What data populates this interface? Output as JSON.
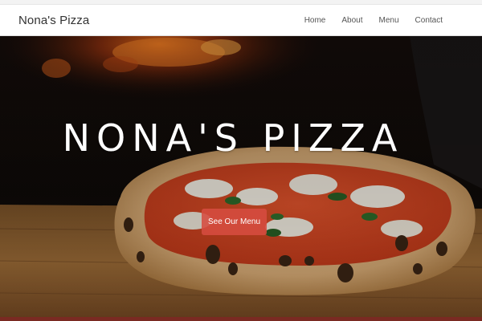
{
  "navbar": {
    "brand": "Nona's Pizza",
    "links": [
      "Home",
      "About",
      "Menu",
      "Contact"
    ]
  },
  "hero": {
    "title": "NONA'S PIZZA",
    "cta_label": "See Our Menu",
    "image_subject": "pizza-photo"
  },
  "colors": {
    "cta_background": "#d64c40",
    "title_text": "#ffffff",
    "navbar_background": "#ffffff"
  }
}
